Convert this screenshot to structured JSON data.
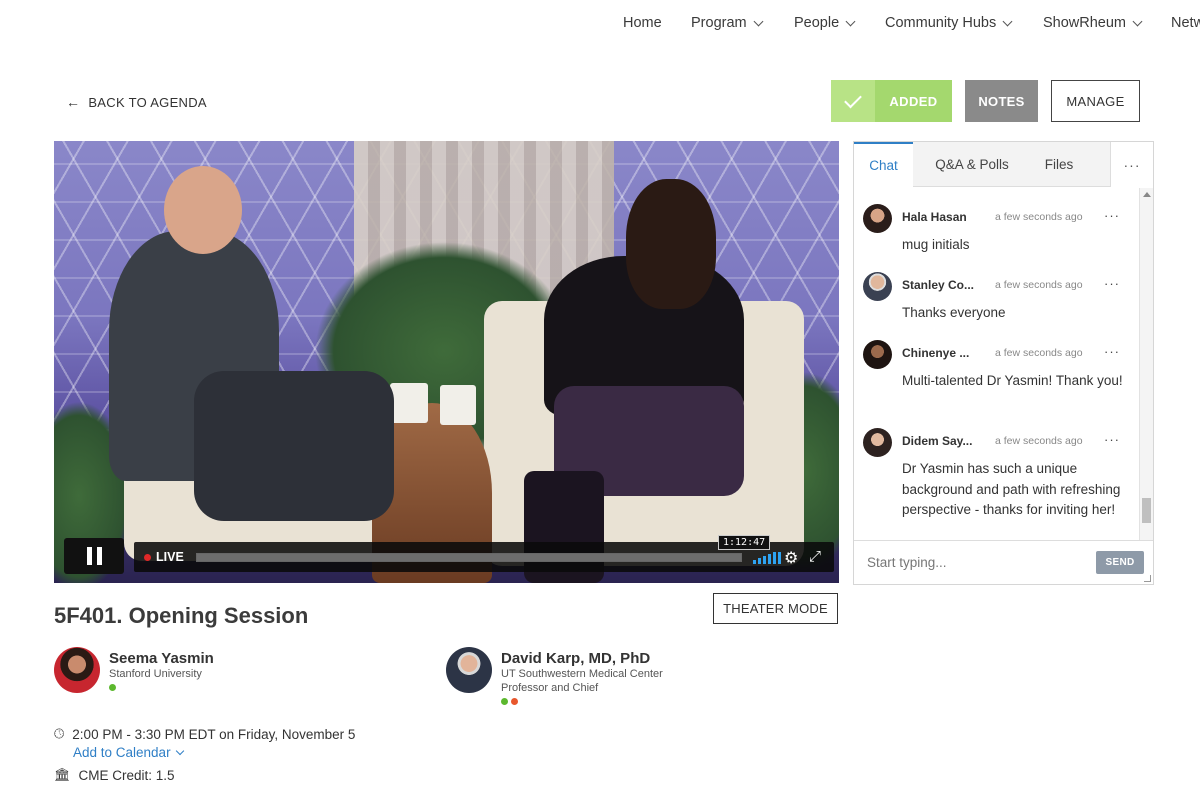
{
  "nav": {
    "items": [
      {
        "label": "Home",
        "has_dropdown": false
      },
      {
        "label": "Program",
        "has_dropdown": true
      },
      {
        "label": "People",
        "has_dropdown": true
      },
      {
        "label": "Community Hubs",
        "has_dropdown": true
      },
      {
        "label": "ShowRheum",
        "has_dropdown": true
      },
      {
        "label": "Netw",
        "has_dropdown": false
      }
    ]
  },
  "actions": {
    "back_label": "BACK TO AGENDA",
    "added_label": "ADDED",
    "notes_label": "NOTES",
    "manage_label": "MANAGE",
    "added_color": "#a4d86e",
    "notes_color": "#8a8a8a"
  },
  "video": {
    "live_label": "LIVE",
    "time_tooltip": "1:12:47",
    "progress": 1.0
  },
  "session": {
    "title": "5F401. Opening Session",
    "theater_label": "THEATER MODE",
    "time": "2:00 PM - 3:30 PM EDT on Friday, November 5",
    "add_calendar_label": "Add to Calendar",
    "cme_credit": "CME Credit: 1.5"
  },
  "speakers": [
    {
      "name": "Seema Yasmin",
      "org_lines": [
        "Stanford University"
      ],
      "status_colors": [
        "#5cb82e"
      ]
    },
    {
      "name": "David Karp, MD, PhD",
      "org_lines": [
        "UT Southwestern Medical Center",
        "Professor and Chief"
      ],
      "status_colors": [
        "#5cb82e",
        "#e8572d"
      ]
    }
  ],
  "chat": {
    "tabs": [
      {
        "label": "Chat",
        "active": true
      },
      {
        "label": "Q&A & Polls",
        "active": false
      },
      {
        "label": "Files",
        "active": false
      }
    ],
    "more_label": "···",
    "messages": [
      {
        "name": "Hala Hasan",
        "time": "a few seconds ago",
        "text": "mug initials"
      },
      {
        "name": "Stanley Co...",
        "time": "a few seconds ago",
        "text": "Thanks everyone"
      },
      {
        "name": "Chinenye ...",
        "time": "a few seconds ago",
        "text": "Multi-talented Dr Yasmin! Thank you!"
      },
      {
        "name": "Didem Say...",
        "time": "a few seconds ago",
        "text": "Dr Yasmin has such a unique background and path with refreshing perspective - thanks for inviting her!"
      }
    ],
    "input_placeholder": "Start typing...",
    "send_label": "SEND",
    "accent_color": "#2f7fc6"
  }
}
